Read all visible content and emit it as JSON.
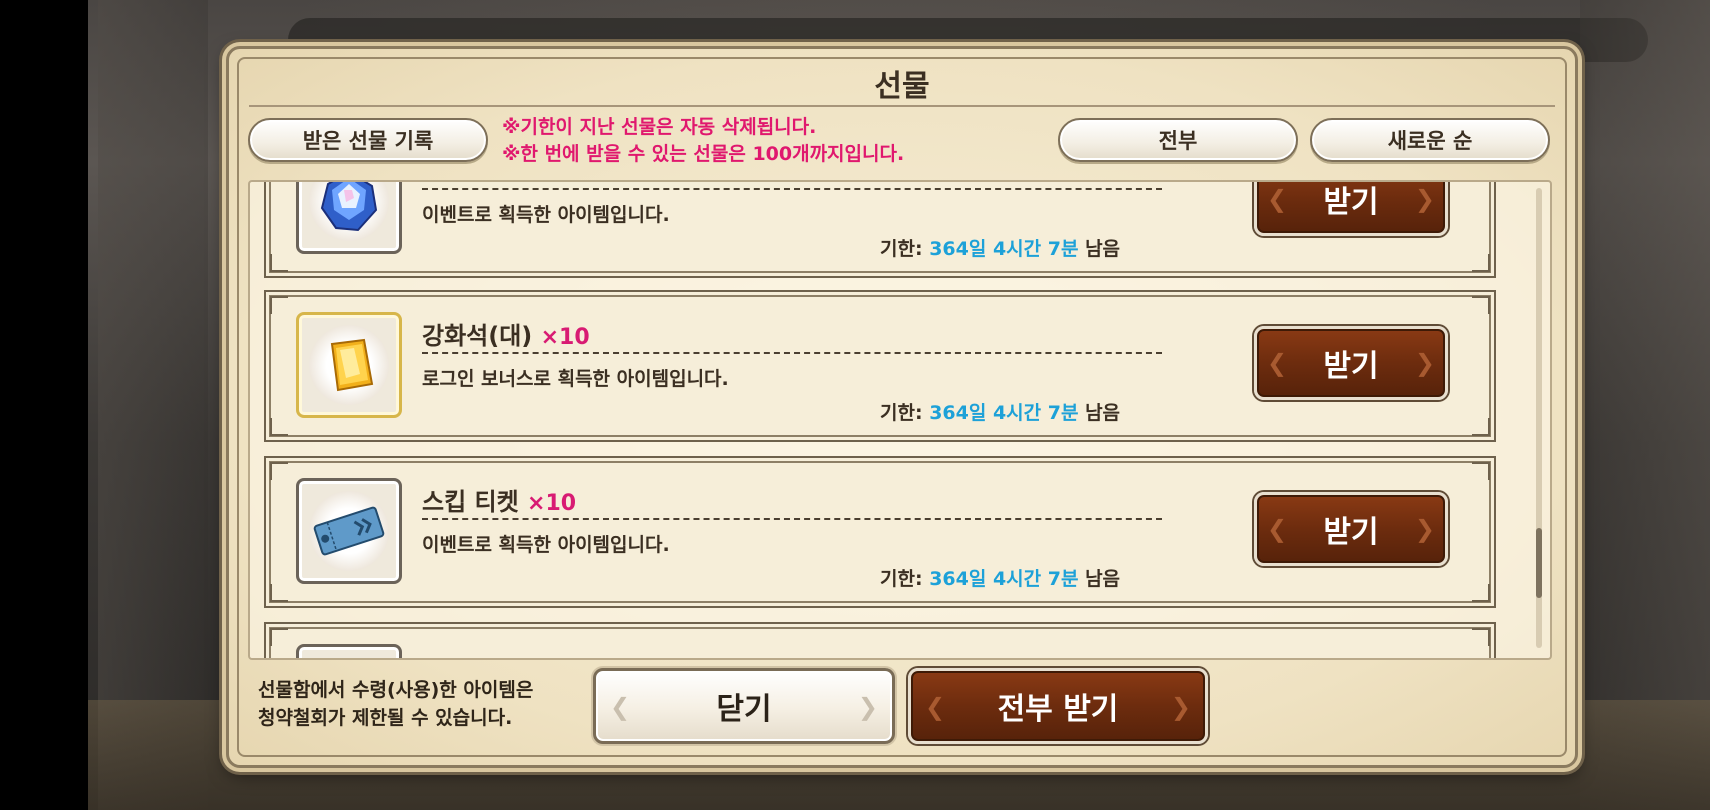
{
  "dialog": {
    "title": "선물"
  },
  "header": {
    "history_button": "받은 선물 기록",
    "notice_line1": "※기한이 지난 선물은 자동 삭제됩니다.",
    "notice_line2": "※한 번에 받을 수 있는 선물은 100개까지입니다.",
    "filter_button": "전부",
    "sort_button": "새로운 순"
  },
  "gifts": [
    {
      "icon": "crystal-gem-icon",
      "name": "",
      "quantity": "",
      "description": "이벤트로 획득한 아이템입니다.",
      "deadline_label": "기한:",
      "remaining": "364일 4시간 7분",
      "remaining_suffix": "남음",
      "claim_label": "받기"
    },
    {
      "icon": "gold-ingot-icon",
      "name": "강화석(대)",
      "quantity": "×10",
      "description": "로그인 보너스로 획득한 아이템입니다.",
      "deadline_label": "기한:",
      "remaining": "364일 4시간 7분",
      "remaining_suffix": "남음",
      "claim_label": "받기"
    },
    {
      "icon": "skip-ticket-icon",
      "name": "스킵 티켓",
      "quantity": "×10",
      "description": "이벤트로 획득한 아이템입니다.",
      "deadline_label": "기한:",
      "remaining": "364일 4시간 7분",
      "remaining_suffix": "남음",
      "claim_label": "받기"
    }
  ],
  "footer": {
    "disclaimer_line1": "선물함에서 수령(사용)한 아이템은",
    "disclaimer_line2": "청약철회가 제한될 수 있습니다.",
    "close_button": "닫기",
    "claim_all_button": "전부 받기"
  },
  "colors": {
    "accent_pink": "#e0186e",
    "remaining_blue": "#1da1d8",
    "button_brown": "#6d2c0e"
  }
}
